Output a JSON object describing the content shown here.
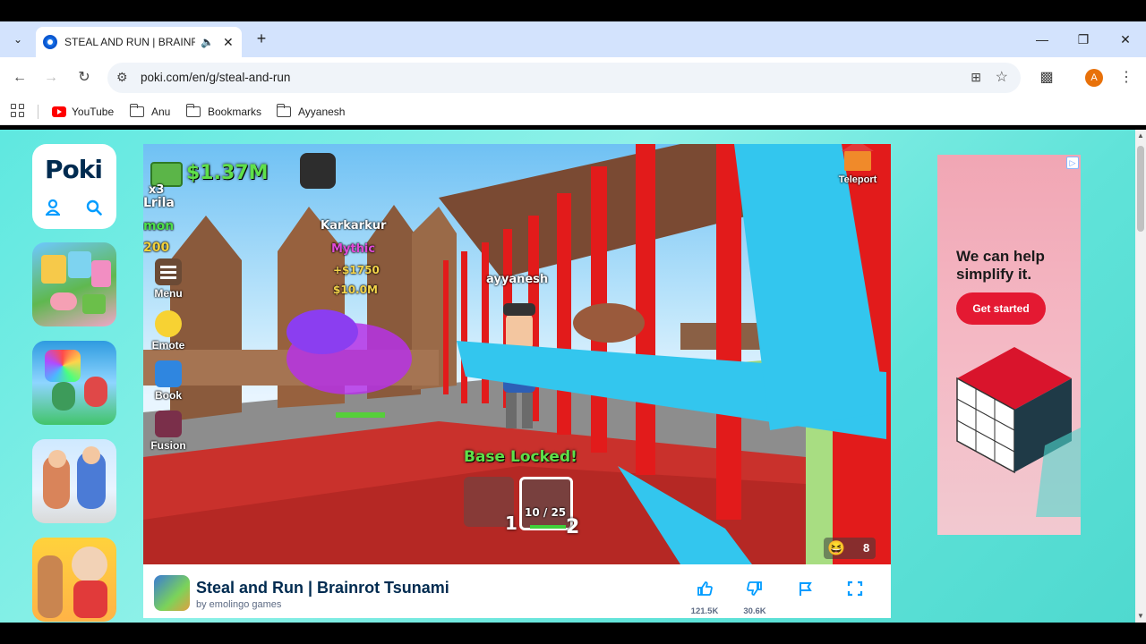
{
  "browser": {
    "tab": {
      "title": "STEAL AND RUN | BRAINROT TSUNAMI",
      "audio_icon": "speaker-icon",
      "close_icon": "close-icon"
    },
    "new_tab_icon": "plus-icon",
    "window_controls": [
      "minimize-icon",
      "restore-icon",
      "close-icon"
    ],
    "url": "poki.com/en/g/steal-and-run",
    "profile_initial": "A",
    "bookmarks": [
      {
        "label": "YouTube",
        "icon": "youtube-icon"
      },
      {
        "label": "Anu",
        "icon": "folder-icon"
      },
      {
        "label": "Bookmarks",
        "icon": "folder-icon"
      },
      {
        "label": "Ayyanesh",
        "icon": "folder-icon"
      }
    ]
  },
  "poki": {
    "logo": "Poki",
    "thumbnails": [
      "game-thumb-1",
      "game-thumb-2",
      "game-thumb-3",
      "game-thumb-4"
    ]
  },
  "game": {
    "money": "$1.37M",
    "multiplier": "x3",
    "left_names": [
      "Lrila",
      "mon",
      "200"
    ],
    "enemy_name": "Karkarkur",
    "rarity": "Mythic",
    "income": "+$1750",
    "value": "$10.0M",
    "player_name": "ayyanesh",
    "teleport": "Teleport",
    "side_buttons": [
      {
        "label": "Menu",
        "icon": "menu-icon"
      },
      {
        "label": "Emote",
        "icon": "emote-icon"
      },
      {
        "label": "Book",
        "icon": "book-icon"
      },
      {
        "label": "Fusion",
        "icon": "fusion-icon"
      }
    ],
    "status": "Base Locked!",
    "slot1": "1",
    "slot2": "2",
    "ammo": "10 / 25",
    "players": "8"
  },
  "info": {
    "title": "Steal and Run | Brainrot Tsunami",
    "author": "by emolingo games",
    "likes": "121.5K",
    "dislikes": "30.6K"
  },
  "ad": {
    "headline": "We can help simplify it.",
    "cta": "Get started",
    "badge": "ad-choices-icon",
    "colors": {
      "background": "#f1a6b4",
      "button": "#e41932"
    }
  }
}
